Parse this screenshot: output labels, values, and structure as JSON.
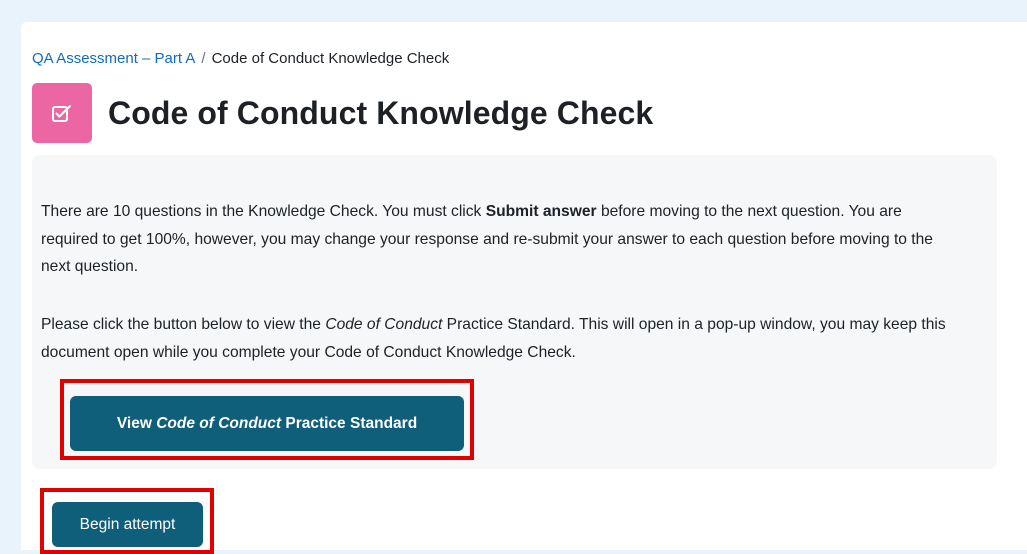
{
  "breadcrumb": {
    "parent": "QA Assessment – Part A",
    "separator": "/",
    "current": "Code of Conduct Knowledge Check"
  },
  "activity_icon": {
    "name": "quiz-checkbox-icon",
    "color": "#eb66a2"
  },
  "page_title": "Code of Conduct Knowledge Check",
  "intro": {
    "p1_a": "There are 10 questions in the Knowledge Check. You must click ",
    "p1_bold": "Submit answer",
    "p1_b": " before moving to the next question. You are required to get 100%, however, you may change your response and re-submit your answer to each question before moving to the next question.",
    "p2_a": "Please click the button below to view the ",
    "p2_italic": "Code of Conduct",
    "p2_b": " Practice Standard. This will open in a pop-up window, you may keep this document open while you complete your Code of Conduct Knowledge Check."
  },
  "view_button": {
    "prefix": "View ",
    "italic": "Code of Conduct",
    "suffix": " Practice Standard"
  },
  "begin_button": {
    "label": "Begin attempt"
  },
  "colors": {
    "button_bg": "#0f5e7a",
    "highlight": "#e00000",
    "link": "#0f6cbf"
  }
}
